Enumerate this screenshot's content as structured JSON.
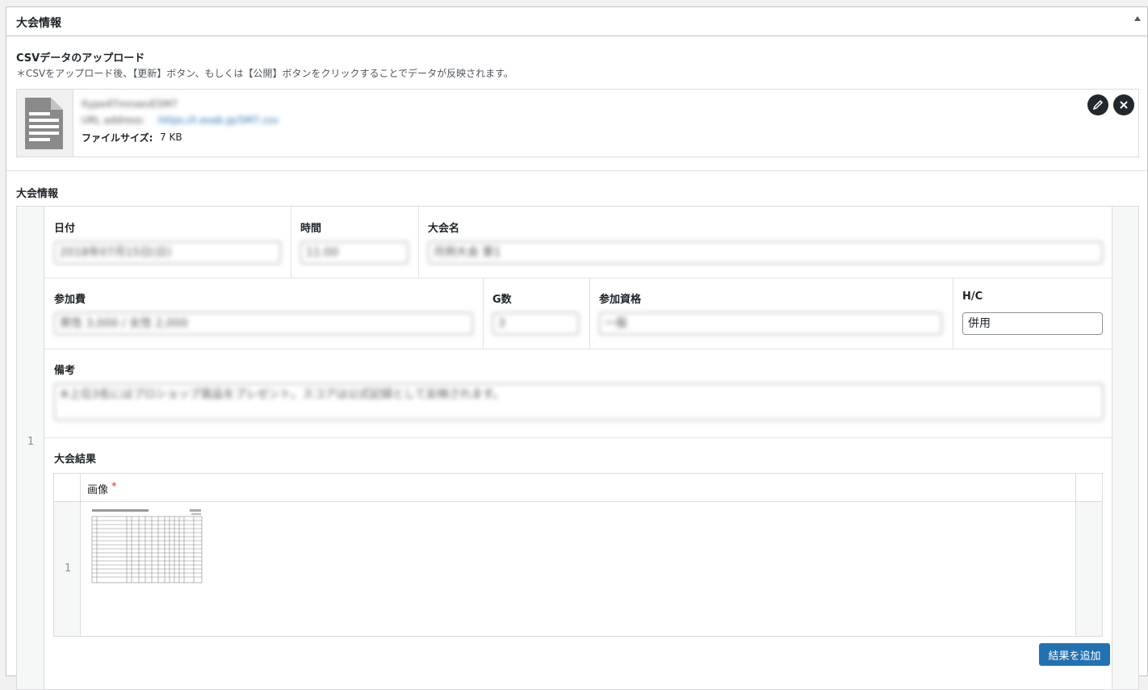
{
  "metabox": {
    "title": "大会情報",
    "csv": {
      "heading": "CSVデータのアップロード",
      "description": "＊CSVをアップロード後、【更新】ボタン、もしくは【公開】ボタンをクリックすることでデータが反映されます。",
      "file": {
        "name": "ltype4TmnxevE5M7",
        "url_label": "URL address:",
        "url_value": "https://t.exab.jp/5M7.csv",
        "size_label": "ファイルサイズ:",
        "size_value": "7 KB"
      }
    },
    "section_title": "大会情報",
    "row_number": "1",
    "fields": {
      "date": {
        "label": "日付",
        "value": "2018年07月15日(日)"
      },
      "time": {
        "label": "時間",
        "value": "11:00"
      },
      "name": {
        "label": "大会名",
        "value": "月例大会 第1"
      },
      "fee": {
        "label": "参加費",
        "value": "男性 3,000 / 女性 2,000"
      },
      "games": {
        "label": "G数",
        "value": "3"
      },
      "qualification": {
        "label": "参加資格",
        "value": "一般"
      },
      "hc": {
        "label": "H/C",
        "value": "併用"
      },
      "notes": {
        "label": "備考",
        "value": "※上位3名にはプロショップ賞品をプレゼント。スコアは公式記録として反映されます。"
      }
    },
    "results": {
      "label": "大会結果",
      "column_header": "画像",
      "required_mark": "*",
      "rows": [
        {
          "number": "1"
        }
      ]
    },
    "add_button": "結果を追加"
  }
}
